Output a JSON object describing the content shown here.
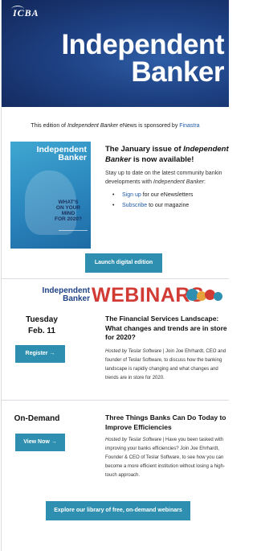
{
  "header": {
    "logo_text": "ICBA",
    "title_line1": "Independent",
    "title_line2": "Banker"
  },
  "sponsor": {
    "prefix": "This edition of ",
    "pub": "Independent Banker",
    "middle": " eNews is sponsored by ",
    "sponsor_name": "Finastra"
  },
  "issue": {
    "cover": {
      "title_line1": "Independent",
      "title_line2": "Banker",
      "question_lines": [
        "WHAT'S",
        "ON YOUR",
        "MIND",
        "FOR 2020?"
      ]
    },
    "title_pre": "The January issue of ",
    "title_em": "Independent Banker",
    "title_post": " is now available!",
    "desc_line1": "Stay up to date on the latest community bankin",
    "desc_line2_pre": "developments with ",
    "desc_line2_em": "Independent Banker",
    "desc_line2_post": ":",
    "bullets": [
      {
        "link": "Sign up",
        "text": " for our eNewsletters"
      },
      {
        "link": "Subscribe",
        "text": " to our magazine"
      }
    ],
    "button": "Launch digital edition"
  },
  "webinars": {
    "logo_line1": "Independent",
    "logo_line2": "Banker",
    "heading": "WEBINARS",
    "colors": {
      "heading": "#d23a34",
      "brand_blue": "#1e4183",
      "button": "#2e8fb0"
    },
    "items": [
      {
        "day_line1": "Tuesday",
        "day_line2": "Feb. 11",
        "button": "Register →",
        "title": "The Financial Services Landscape: What changes and trends are in store for 2020?",
        "hosted": "Hosted by Teslar Software",
        "desc": " | Join Joe Ehrhardt, CEO and founder of Teslar Software, to discuss how the banking landscape is rapidly changing and what changes and trends are in store for 2020."
      },
      {
        "day_line1": "On-Demand",
        "day_line2": "",
        "button": "View Now →",
        "title": "Three Things Banks Can Do Today to Improve Efficiencies",
        "hosted": "Hosted by Teslar Software",
        "desc": " | Have you been tasked with improving your banks efficiencies? Join Joe Ehrhardt, Founder & CEO of Teslar Software, to see how you can become a more efficient institution without losing a high-touch approach."
      }
    ],
    "explore_button": "Explore our library of free, on-demand webinars"
  }
}
